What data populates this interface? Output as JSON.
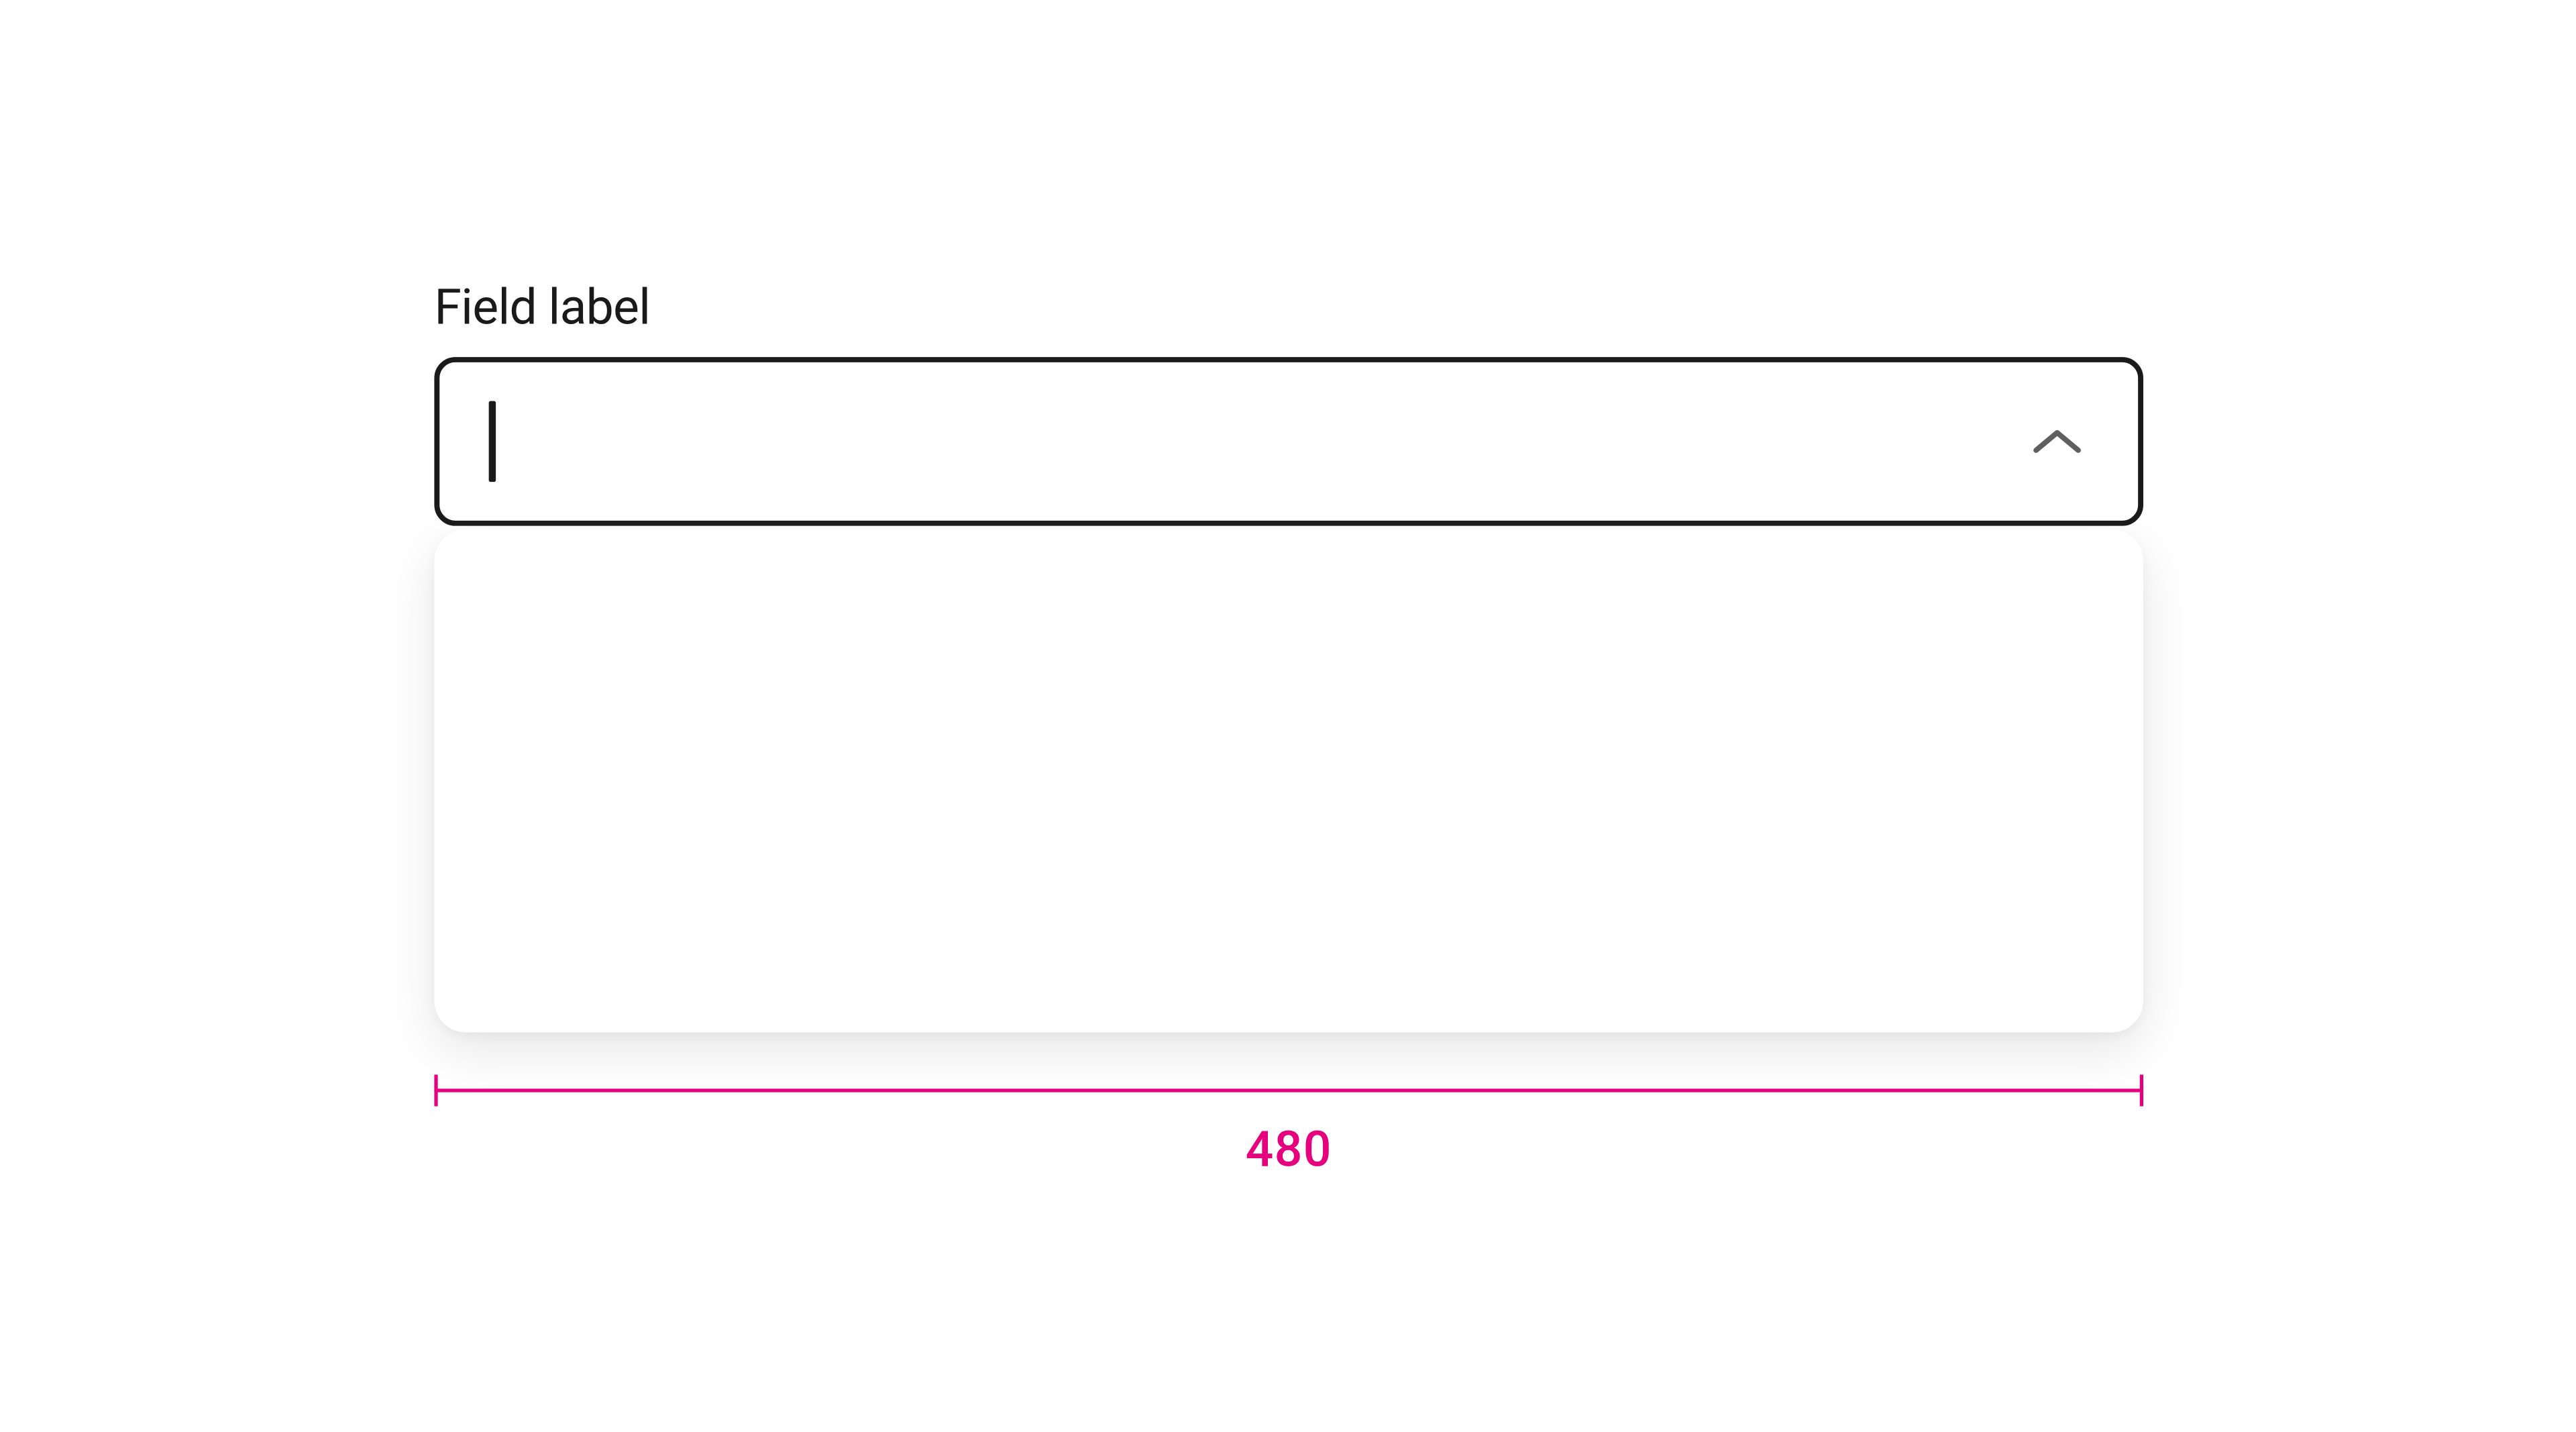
{
  "field": {
    "label": "Field label",
    "value": ""
  },
  "dimension": {
    "width_label": "480"
  },
  "colors": {
    "annotation": "#e6007e",
    "border": "#1a1a1a",
    "chevron": "#5f5f5f"
  }
}
